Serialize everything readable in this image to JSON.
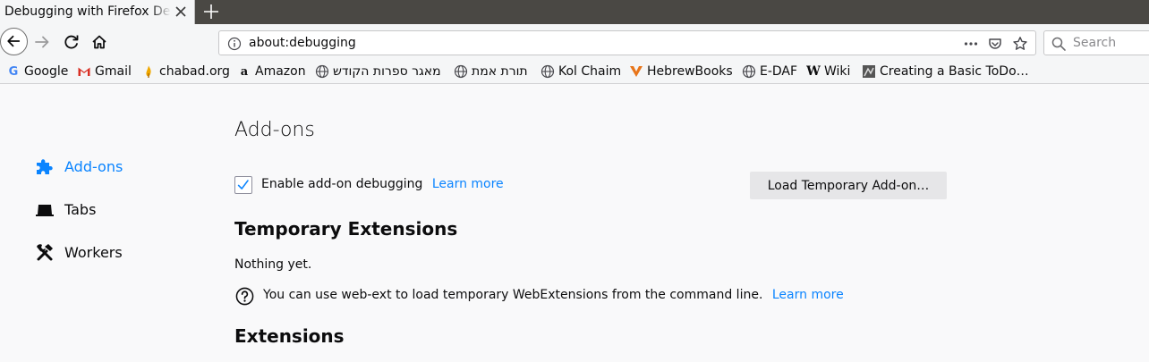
{
  "tab": {
    "title": "Debugging with Firefox Developer Tools"
  },
  "urlbar": {
    "url": "about:debugging",
    "search_placeholder": "Search"
  },
  "bookmarks": [
    {
      "label": "Google",
      "icon": "google-icon"
    },
    {
      "label": "Gmail",
      "icon": "gmail-icon"
    },
    {
      "label": "chabad.org",
      "icon": "chabad-icon"
    },
    {
      "label": "Amazon",
      "icon": "amazon-icon"
    },
    {
      "label": "מאגר ספרות הקודש",
      "icon": "globe-icon"
    },
    {
      "label": "תורת אמת",
      "icon": "globe-icon"
    },
    {
      "label": "Kol Chaim",
      "icon": "globe-icon"
    },
    {
      "label": "HebrewBooks",
      "icon": "hebrewbooks-icon"
    },
    {
      "label": "E-DAF",
      "icon": "globe-icon"
    },
    {
      "label": "Wiki",
      "icon": "wikipedia-icon"
    },
    {
      "label": "Creating a Basic ToDo…",
      "icon": "page-icon"
    }
  ],
  "sidebar": {
    "items": [
      {
        "label": "Add-ons",
        "icon": "puzzle-icon",
        "active": true
      },
      {
        "label": "Tabs",
        "icon": "tab-icon",
        "active": false
      },
      {
        "label": "Workers",
        "icon": "tools-icon",
        "active": false
      }
    ]
  },
  "main": {
    "heading": "Add-ons",
    "enable_debugging_label": "Enable add-on debugging",
    "enable_debugging_checked": true,
    "learn_more": "Learn more",
    "load_button": "Load Temporary Add-on…",
    "temporary_heading": "Temporary Extensions",
    "nothing_yet": "Nothing yet.",
    "web_ext_hint": "You can use web-ext to load temporary WebExtensions from the command line.",
    "extensions_heading": "Extensions"
  },
  "colors": {
    "accent": "#0a84ff",
    "tabstrip": "#4a4844",
    "toolbar": "#f5f6f7"
  }
}
